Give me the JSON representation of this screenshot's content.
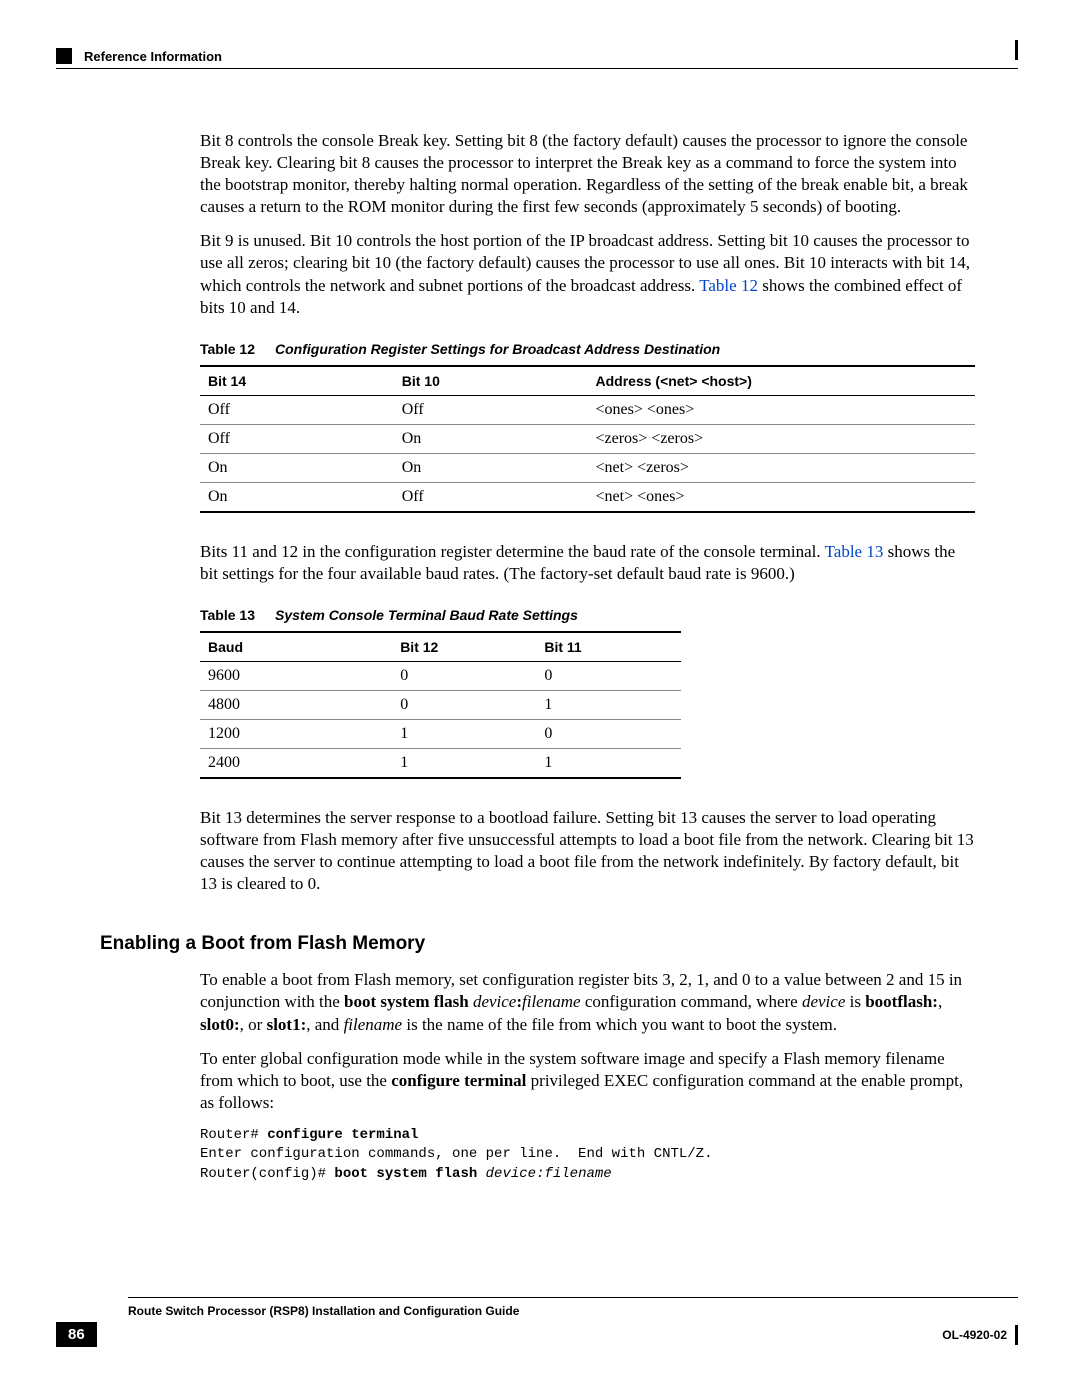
{
  "header": {
    "breadcrumb": "Reference Information"
  },
  "para1": "Bit 8 controls the console Break key. Setting bit 8 (the factory default) causes the processor to ignore the console Break key. Clearing bit 8 causes the processor to interpret the Break key as a command to force the system into the bootstrap monitor, thereby halting normal operation. Regardless of the setting of the break enable bit, a break causes a return to the ROM monitor during the first few seconds (approximately 5 seconds) of booting.",
  "para2_a": "Bit 9 is unused. Bit 10 controls the host portion of the IP broadcast address. Setting bit 10 causes the processor to use all zeros; clearing bit 10 (the factory default) causes the processor to use all ones. Bit 10 interacts with bit 14, which controls the network and subnet portions of the broadcast address. ",
  "para2_link": "Table 12",
  "para2_b": " shows the combined effect of bits 10 and 14.",
  "table12": {
    "caption_label": "Table 12",
    "caption_text": "Configuration Register Settings for Broadcast Address Destination",
    "headers": [
      "Bit 14",
      "Bit 10",
      "Address (<net> <host>)"
    ],
    "rows": [
      [
        "Off",
        "Off",
        "<ones> <ones>"
      ],
      [
        "Off",
        "On",
        "<zeros> <zeros>"
      ],
      [
        "On",
        "On",
        "<net> <zeros>"
      ],
      [
        "On",
        "Off",
        "<net> <ones>"
      ]
    ]
  },
  "para3_a": "Bits 11 and 12 in the configuration register determine the baud rate of the console terminal. ",
  "para3_link": "Table 13",
  "para3_b": " shows the bit settings for the four available baud rates. (The factory-set default baud rate is 9600.)",
  "table13": {
    "caption_label": "Table 13",
    "caption_text": "System Console Terminal Baud Rate Settings",
    "headers": [
      "Baud",
      "Bit 12",
      "Bit 11"
    ],
    "rows": [
      [
        "9600",
        "0",
        "0"
      ],
      [
        "4800",
        "0",
        "1"
      ],
      [
        "1200",
        "1",
        "0"
      ],
      [
        "2400",
        "1",
        "1"
      ]
    ]
  },
  "para4": "Bit 13 determines the server response to a bootload failure. Setting bit 13 causes the server to load operating software from Flash memory after five unsuccessful attempts to load a boot file from the network. Clearing bit 13 causes the server to continue attempting to load a boot file from the network indefinitely. By factory default, bit 13 is cleared to 0.",
  "section": {
    "heading": "Enabling a Boot from Flash Memory",
    "p1_parts": {
      "a": "To enable a boot from Flash memory, set configuration register bits 3, 2, 1, and 0 to a value between 2 and 15 in conjunction with the ",
      "b_bold": "boot system flash ",
      "c_italic1": "device",
      "d_bold2": ":",
      "e_italic2": "filename",
      "f": " configuration command, where ",
      "g_italic3": "device",
      "h": " is ",
      "i_bold3": "bootflash:",
      "j": ", ",
      "k_bold4": "slot0:",
      "l": ", or ",
      "m_bold5": "slot1:",
      "n": ", and ",
      "o_italic4": "filename",
      "p": " is the name of the file from which you want to boot the system."
    },
    "p2_parts": {
      "a": "To enter global configuration mode while in the system software image and specify a Flash memory filename from which to boot, use the ",
      "b_bold": "configure terminal",
      "c": " privileged EXEC configuration command at the enable prompt, as follows:"
    },
    "code": {
      "line1_prompt": "Router# ",
      "line1_cmd": "configure terminal",
      "line2": "Enter configuration commands, one per line.  End with CNTL/Z.",
      "line3_prompt": "Router(config)# ",
      "line3_cmd": "boot system flash ",
      "line3_arg": "device:filename"
    }
  },
  "footer": {
    "title": "Route Switch Processor (RSP8) Installation and Configuration Guide",
    "page": "86",
    "docid": "OL-4920-02"
  }
}
